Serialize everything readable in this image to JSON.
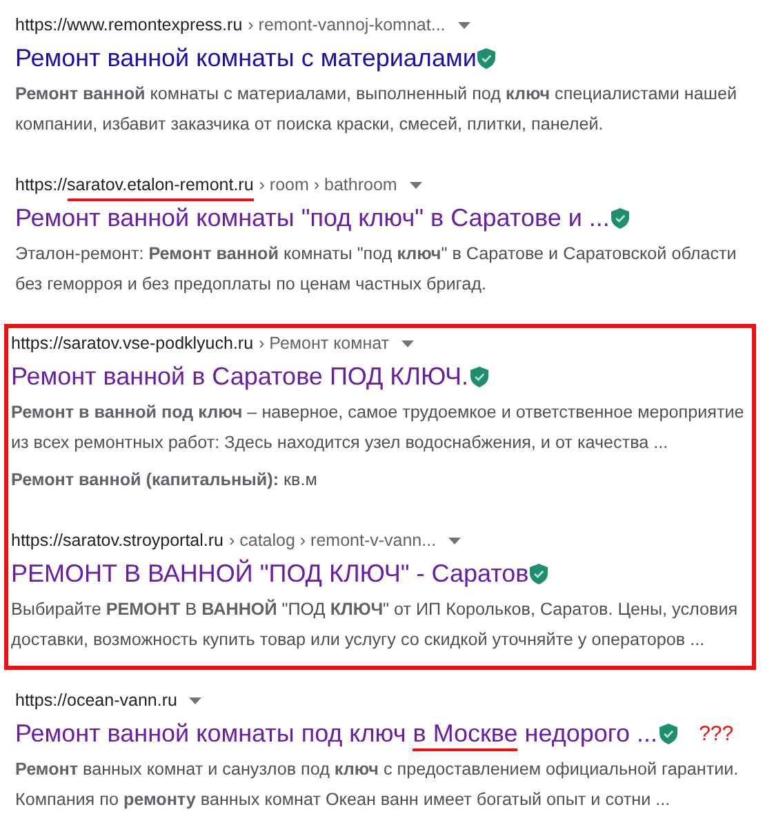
{
  "groups": [
    {
      "kind": "plain",
      "results": [
        {
          "url_parts": [
            {
              "text": "https://www.remontexpress.ru",
              "underlined": false
            }
          ],
          "breadcrumb": "› remont-vannoj-komnat...",
          "title_parts": [
            {
              "text": "Ремонт ванной комнаты с материалами",
              "underlined": false
            }
          ],
          "visited": false,
          "verified": true,
          "snippet": "**Ремонт ванной** комнаты с материалами, выполненный под **ключ** специалистами нашей компании, избавит заказчика от поиска краски, смесей, плитки, панелей."
        }
      ]
    },
    {
      "kind": "plain",
      "results": [
        {
          "url_parts": [
            {
              "text": "https://",
              "underlined": false
            },
            {
              "text": "saratov.etalon-remont.ru",
              "underlined": true
            }
          ],
          "breadcrumb": "› room › bathroom",
          "title_parts": [
            {
              "text": "Ремонт ванной комнаты \"под ключ\" в Саратове и ...",
              "underlined": false
            }
          ],
          "visited": true,
          "verified": true,
          "snippet": "Эталон-ремонт: **Ремонт ванной** комнаты \"под **ключ**\" в Саратове и Саратовской области без геморроя и без предоплаты по ценам частных бригад."
        }
      ]
    },
    {
      "kind": "framed",
      "results": [
        {
          "url_parts": [
            {
              "text": "https://saratov.vse-podklyuch.ru",
              "underlined": false
            }
          ],
          "breadcrumb": "› Ремонт комнат",
          "title_parts": [
            {
              "text": "Ремонт ванной в Саратове ПОД КЛЮЧ.",
              "underlined": false
            }
          ],
          "visited": true,
          "verified": true,
          "snippet": "**Ремонт в ванной под ключ** – наверное, самое трудоемкое и ответственное мероприятие из всех ремонтных работ: Здесь находится узел водоснабжения, и от качества ...",
          "extra": "**Ремонт ванной (капитальный):** кв.м"
        },
        {
          "url_parts": [
            {
              "text": "https://saratov.stroyportal.ru",
              "underlined": false
            }
          ],
          "breadcrumb": "› catalog › remont-v-vann...",
          "title_parts": [
            {
              "text": "РЕМОНТ В ВАННОЙ \"ПОД КЛЮЧ\" - Саратов",
              "underlined": false
            }
          ],
          "visited": true,
          "verified": true,
          "snippet": "Выбирайте **РЕМОНТ** В **ВАННОЙ** \"ПОД **КЛЮЧ**\" от ИП Корольков, Саратов. Цены, условия доставки, возможность купить товар или услугу со скидкой уточняйте у операторов ..."
        }
      ]
    },
    {
      "kind": "plain",
      "results": [
        {
          "url_parts": [
            {
              "text": "https://ocean-vann.ru",
              "underlined": false
            }
          ],
          "title_parts": [
            {
              "text": "Ремонт ванной комнаты под ключ ",
              "underlined": false
            },
            {
              "text": "в Москве",
              "underlined": true
            },
            {
              "text": " недорого ...",
              "underlined": false
            }
          ],
          "visited": true,
          "verified": true,
          "note": "???",
          "snippet": "**Ремонт** ванных комнат и санузлов под **ключ** с предоставлением официальной гарантии. Компания по **ремонту** ванных комнат Океан ванн имеет богатый опыт и сотни ..."
        }
      ]
    }
  ]
}
